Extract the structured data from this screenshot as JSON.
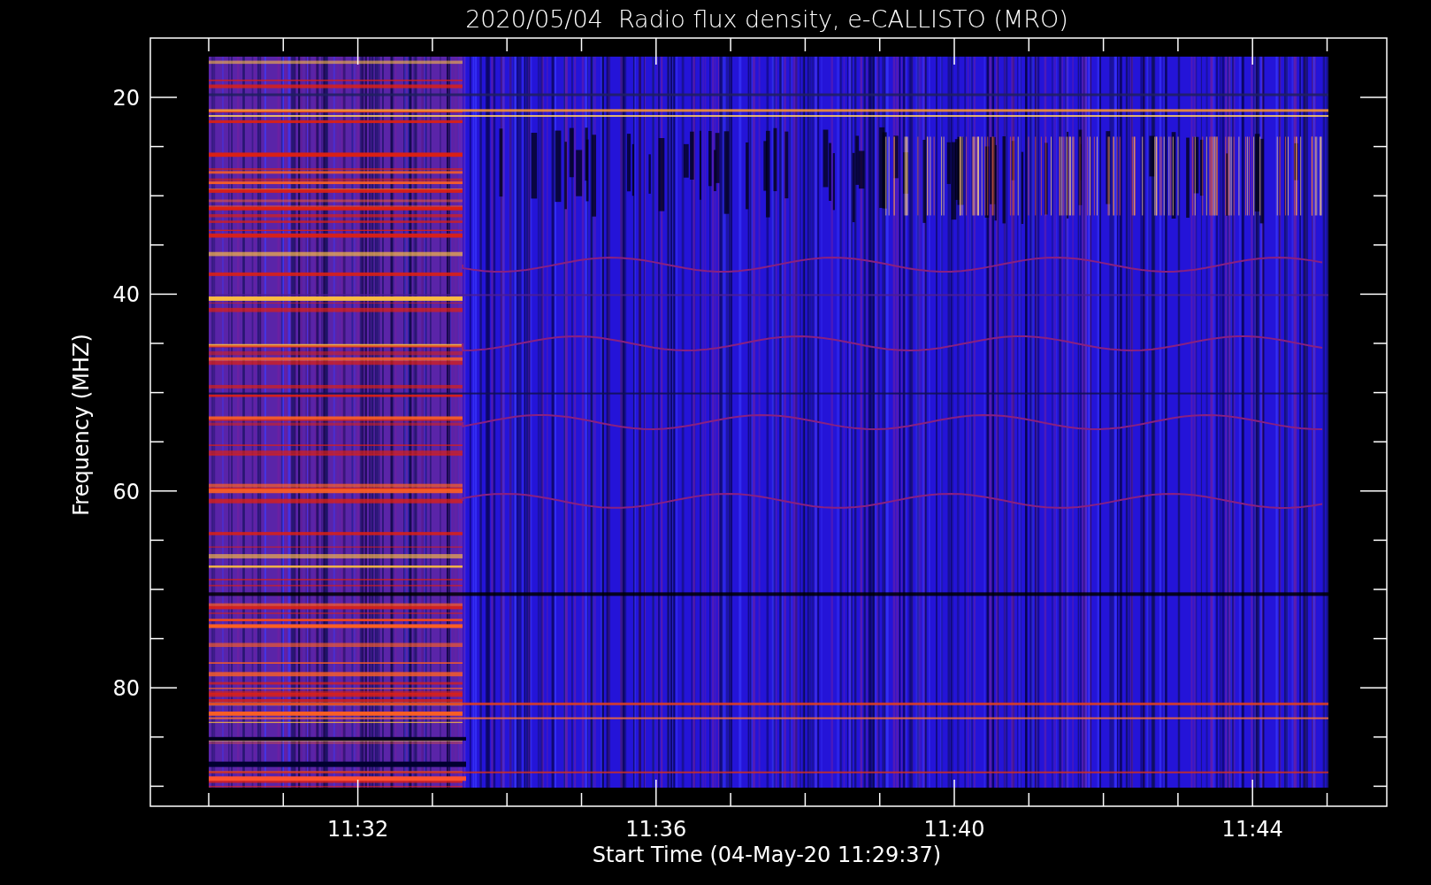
{
  "title": "2020/05/04  Radio flux density, e-CALLISTO (MRO)",
  "y_axis": {
    "label": "Frequency (MHZ)",
    "ticks": [
      "20",
      "40",
      "60",
      "80"
    ]
  },
  "x_axis": {
    "label": "Start Time (04-May-20 11:29:37)",
    "ticks": [
      "11:32",
      "11:36",
      "11:40",
      "11:44"
    ]
  }
}
